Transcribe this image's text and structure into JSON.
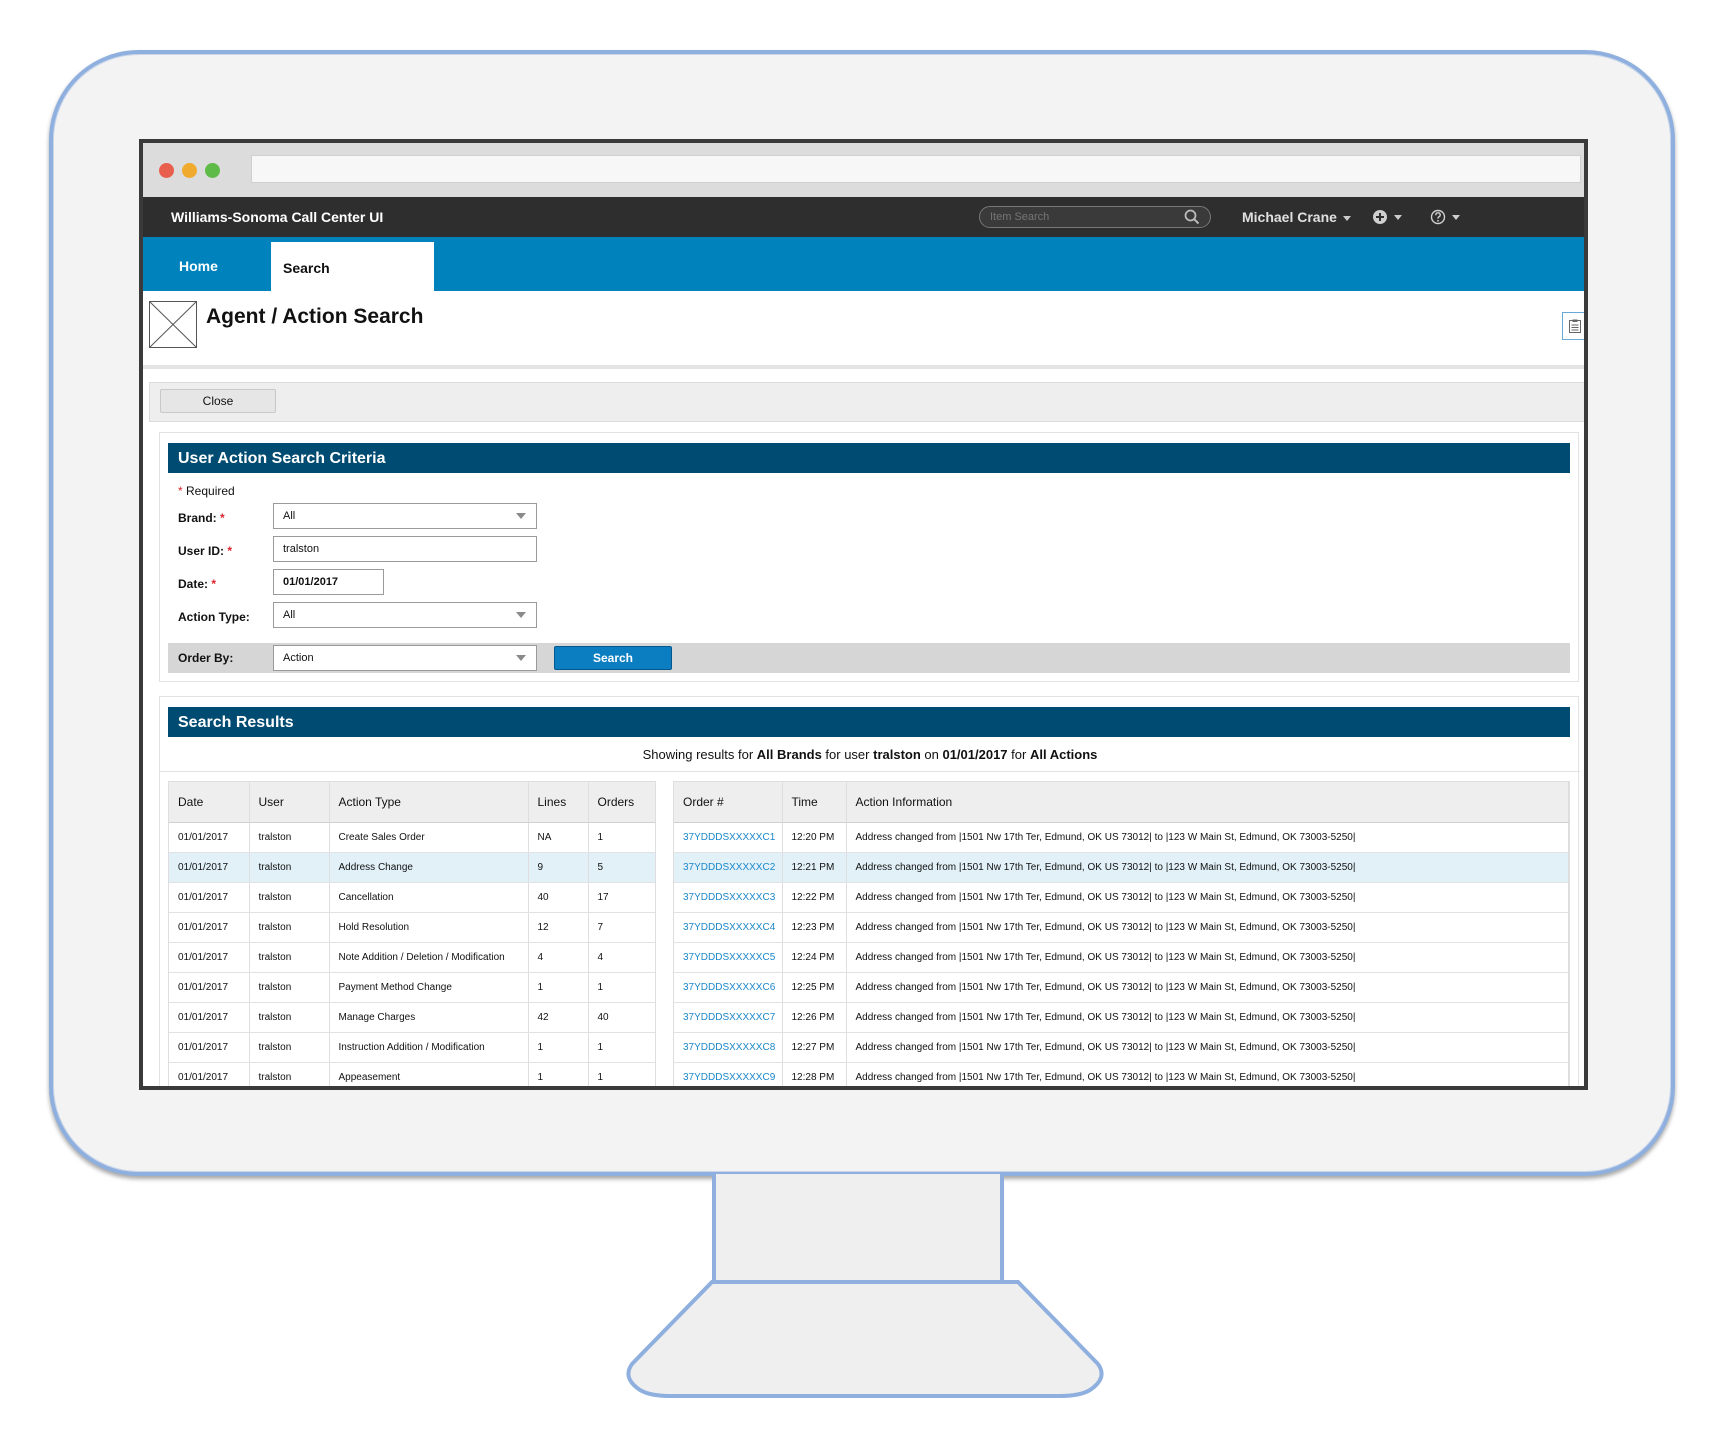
{
  "app": {
    "title": "Williams-Sonoma Call Center UI",
    "item_search_placeholder": "Item Search",
    "user_name": "Michael Crane"
  },
  "nav": {
    "home_label": "Home",
    "search_label": "Search"
  },
  "page": {
    "title": "Agent / Action Search"
  },
  "toolbar": {
    "close_label": "Close"
  },
  "criteria": {
    "header": "User Action Search Criteria",
    "required_note": "Required",
    "required_marker": "*",
    "brand_label": "Brand:",
    "brand_value": "All",
    "user_id_label": "User ID:",
    "user_id_value": "tralston",
    "date_label": "Date:",
    "date_value": "01/01/2017",
    "action_type_label": "Action Type:",
    "action_type_value": "All",
    "order_by_label": "Order By:",
    "order_by_value": "Action",
    "search_label": "Search"
  },
  "results": {
    "header": "Search Results",
    "summary": {
      "prefix": "Showing results for ",
      "brand": "All Brands",
      "mid1": " for user ",
      "user": "tralston",
      "mid2": " on ",
      "date": "01/01/2017",
      "mid3": " for ",
      "actions": "All Actions"
    },
    "left_columns": [
      "Date",
      "User",
      "Action Type",
      "Lines",
      "Orders"
    ],
    "right_columns": [
      "Order #",
      "Time",
      "Action Information"
    ],
    "highlight_row": 1,
    "left_rows": [
      [
        "01/01/2017",
        "tralston",
        "Create Sales Order",
        "NA",
        "1"
      ],
      [
        "01/01/2017",
        "tralston",
        "Address Change",
        "9",
        "5"
      ],
      [
        "01/01/2017",
        "tralston",
        "Cancellation",
        "40",
        "17"
      ],
      [
        "01/01/2017",
        "tralston",
        "Hold Resolution",
        "12",
        "7"
      ],
      [
        "01/01/2017",
        "tralston",
        "Note Addition / Deletion / Modification",
        "4",
        "4"
      ],
      [
        "01/01/2017",
        "tralston",
        "Payment Method Change",
        "1",
        "1"
      ],
      [
        "01/01/2017",
        "tralston",
        "Manage Charges",
        "42",
        "40"
      ],
      [
        "01/01/2017",
        "tralston",
        "Instruction Addition / Modification",
        "1",
        "1"
      ],
      [
        "01/01/2017",
        "tralston",
        "Appeasement",
        "1",
        "1"
      ]
    ],
    "right_rows": [
      [
        "37YDDDSXXXXXC1",
        "12:20 PM",
        "Address changed from |1501 Nw 17th Ter, Edmund, OK US 73012| to |123 W Main St, Edmund, OK 73003-5250|"
      ],
      [
        "37YDDDSXXXXXC2",
        "12:21 PM",
        "Address changed from |1501 Nw 17th Ter, Edmund, OK US 73012| to |123 W Main St, Edmund, OK 73003-5250|"
      ],
      [
        "37YDDDSXXXXXC3",
        "12:22 PM",
        "Address changed from |1501 Nw 17th Ter, Edmund, OK US 73012| to |123 W Main St, Edmund, OK 73003-5250|"
      ],
      [
        "37YDDDSXXXXXC4",
        "12:23 PM",
        "Address changed from |1501 Nw 17th Ter, Edmund, OK US 73012| to |123 W Main St, Edmund, OK 73003-5250|"
      ],
      [
        "37YDDDSXXXXXC5",
        "12:24 PM",
        "Address changed from |1501 Nw 17th Ter, Edmund, OK US 73012| to |123 W Main St, Edmund, OK 73003-5250|"
      ],
      [
        "37YDDDSXXXXXC6",
        "12:25 PM",
        "Address changed from |1501 Nw 17th Ter, Edmund, OK US 73012| to |123 W Main St, Edmund, OK 73003-5250|"
      ],
      [
        "37YDDDSXXXXXC7",
        "12:26 PM",
        "Address changed from |1501 Nw 17th Ter, Edmund, OK US 73012| to |123 W Main St, Edmund, OK 73003-5250|"
      ],
      [
        "37YDDDSXXXXXC8",
        "12:27 PM",
        "Address changed from |1501 Nw 17th Ter, Edmund, OK US 73012| to |123 W Main St, Edmund, OK 73003-5250|"
      ],
      [
        "37YDDDSXXXXXC9",
        "12:28 PM",
        "Address changed from |1501 Nw 17th Ter, Edmund, OK US 73012| to |123 W Main St, Edmund, OK 73003-5250|"
      ]
    ]
  },
  "icons": {
    "search": "search-icon",
    "plus": "plus-circle-icon",
    "help": "help-circle-icon",
    "dropdown": "chevron-down-icon",
    "clipboard": "clipboard-icon",
    "image_placeholder": "image-placeholder-icon"
  },
  "colors": {
    "app_bar": "#2e2e2e",
    "nav_bar": "#0082bd",
    "panel_header": "#004b71",
    "search_button": "#0b7ec2",
    "link": "#1b87c9",
    "required": "#d8262e",
    "highlight_row": "#e2f1f8"
  }
}
